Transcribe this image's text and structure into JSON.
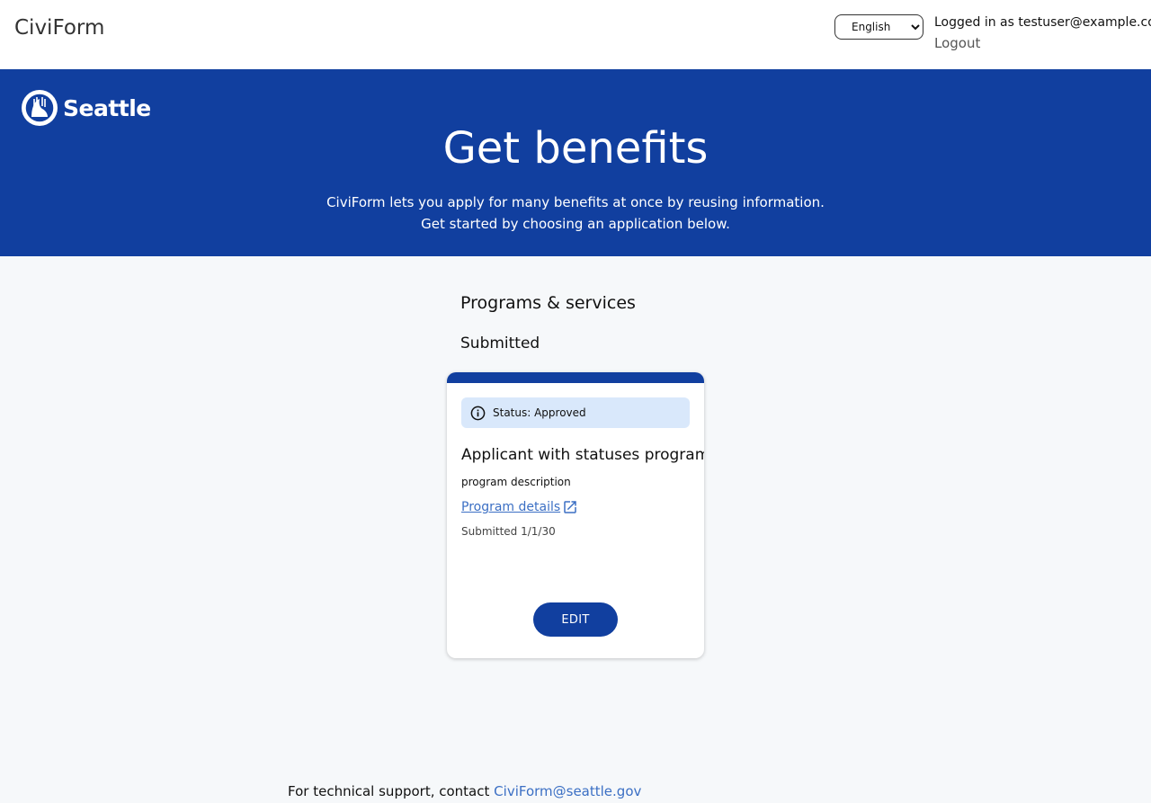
{
  "header": {
    "brand": "CiviForm",
    "language": {
      "selected": "English",
      "options": [
        "English"
      ]
    },
    "logged_in_text": "Logged in as testuser@example.com",
    "logout_label": "Logout"
  },
  "hero": {
    "logo_text": "Seattle",
    "title": "Get benefits",
    "subtitle_line1": "CiviForm lets you apply for many benefits at once by reusing information.",
    "subtitle_line2": "Get started by choosing an application below."
  },
  "main": {
    "section_heading": "Programs & services",
    "group_heading": "Submitted",
    "programs": [
      {
        "status": "Status: Approved",
        "status_icon": "info-icon",
        "title": "Applicant with statuses program",
        "description": "program description",
        "details_link": "Program details",
        "details_icon": "external-link-icon",
        "submitted": "Submitted 1/1/30",
        "action_label": "EDIT"
      }
    ]
  },
  "footer": {
    "support_text": "For technical support, contact",
    "support_email": "CiviForm@seattle.gov"
  },
  "colors": {
    "primary": "#113f9f",
    "status_bg": "#d9e8fb",
    "link": "#3b6fc4",
    "page_bg": "#f6f8fa"
  }
}
